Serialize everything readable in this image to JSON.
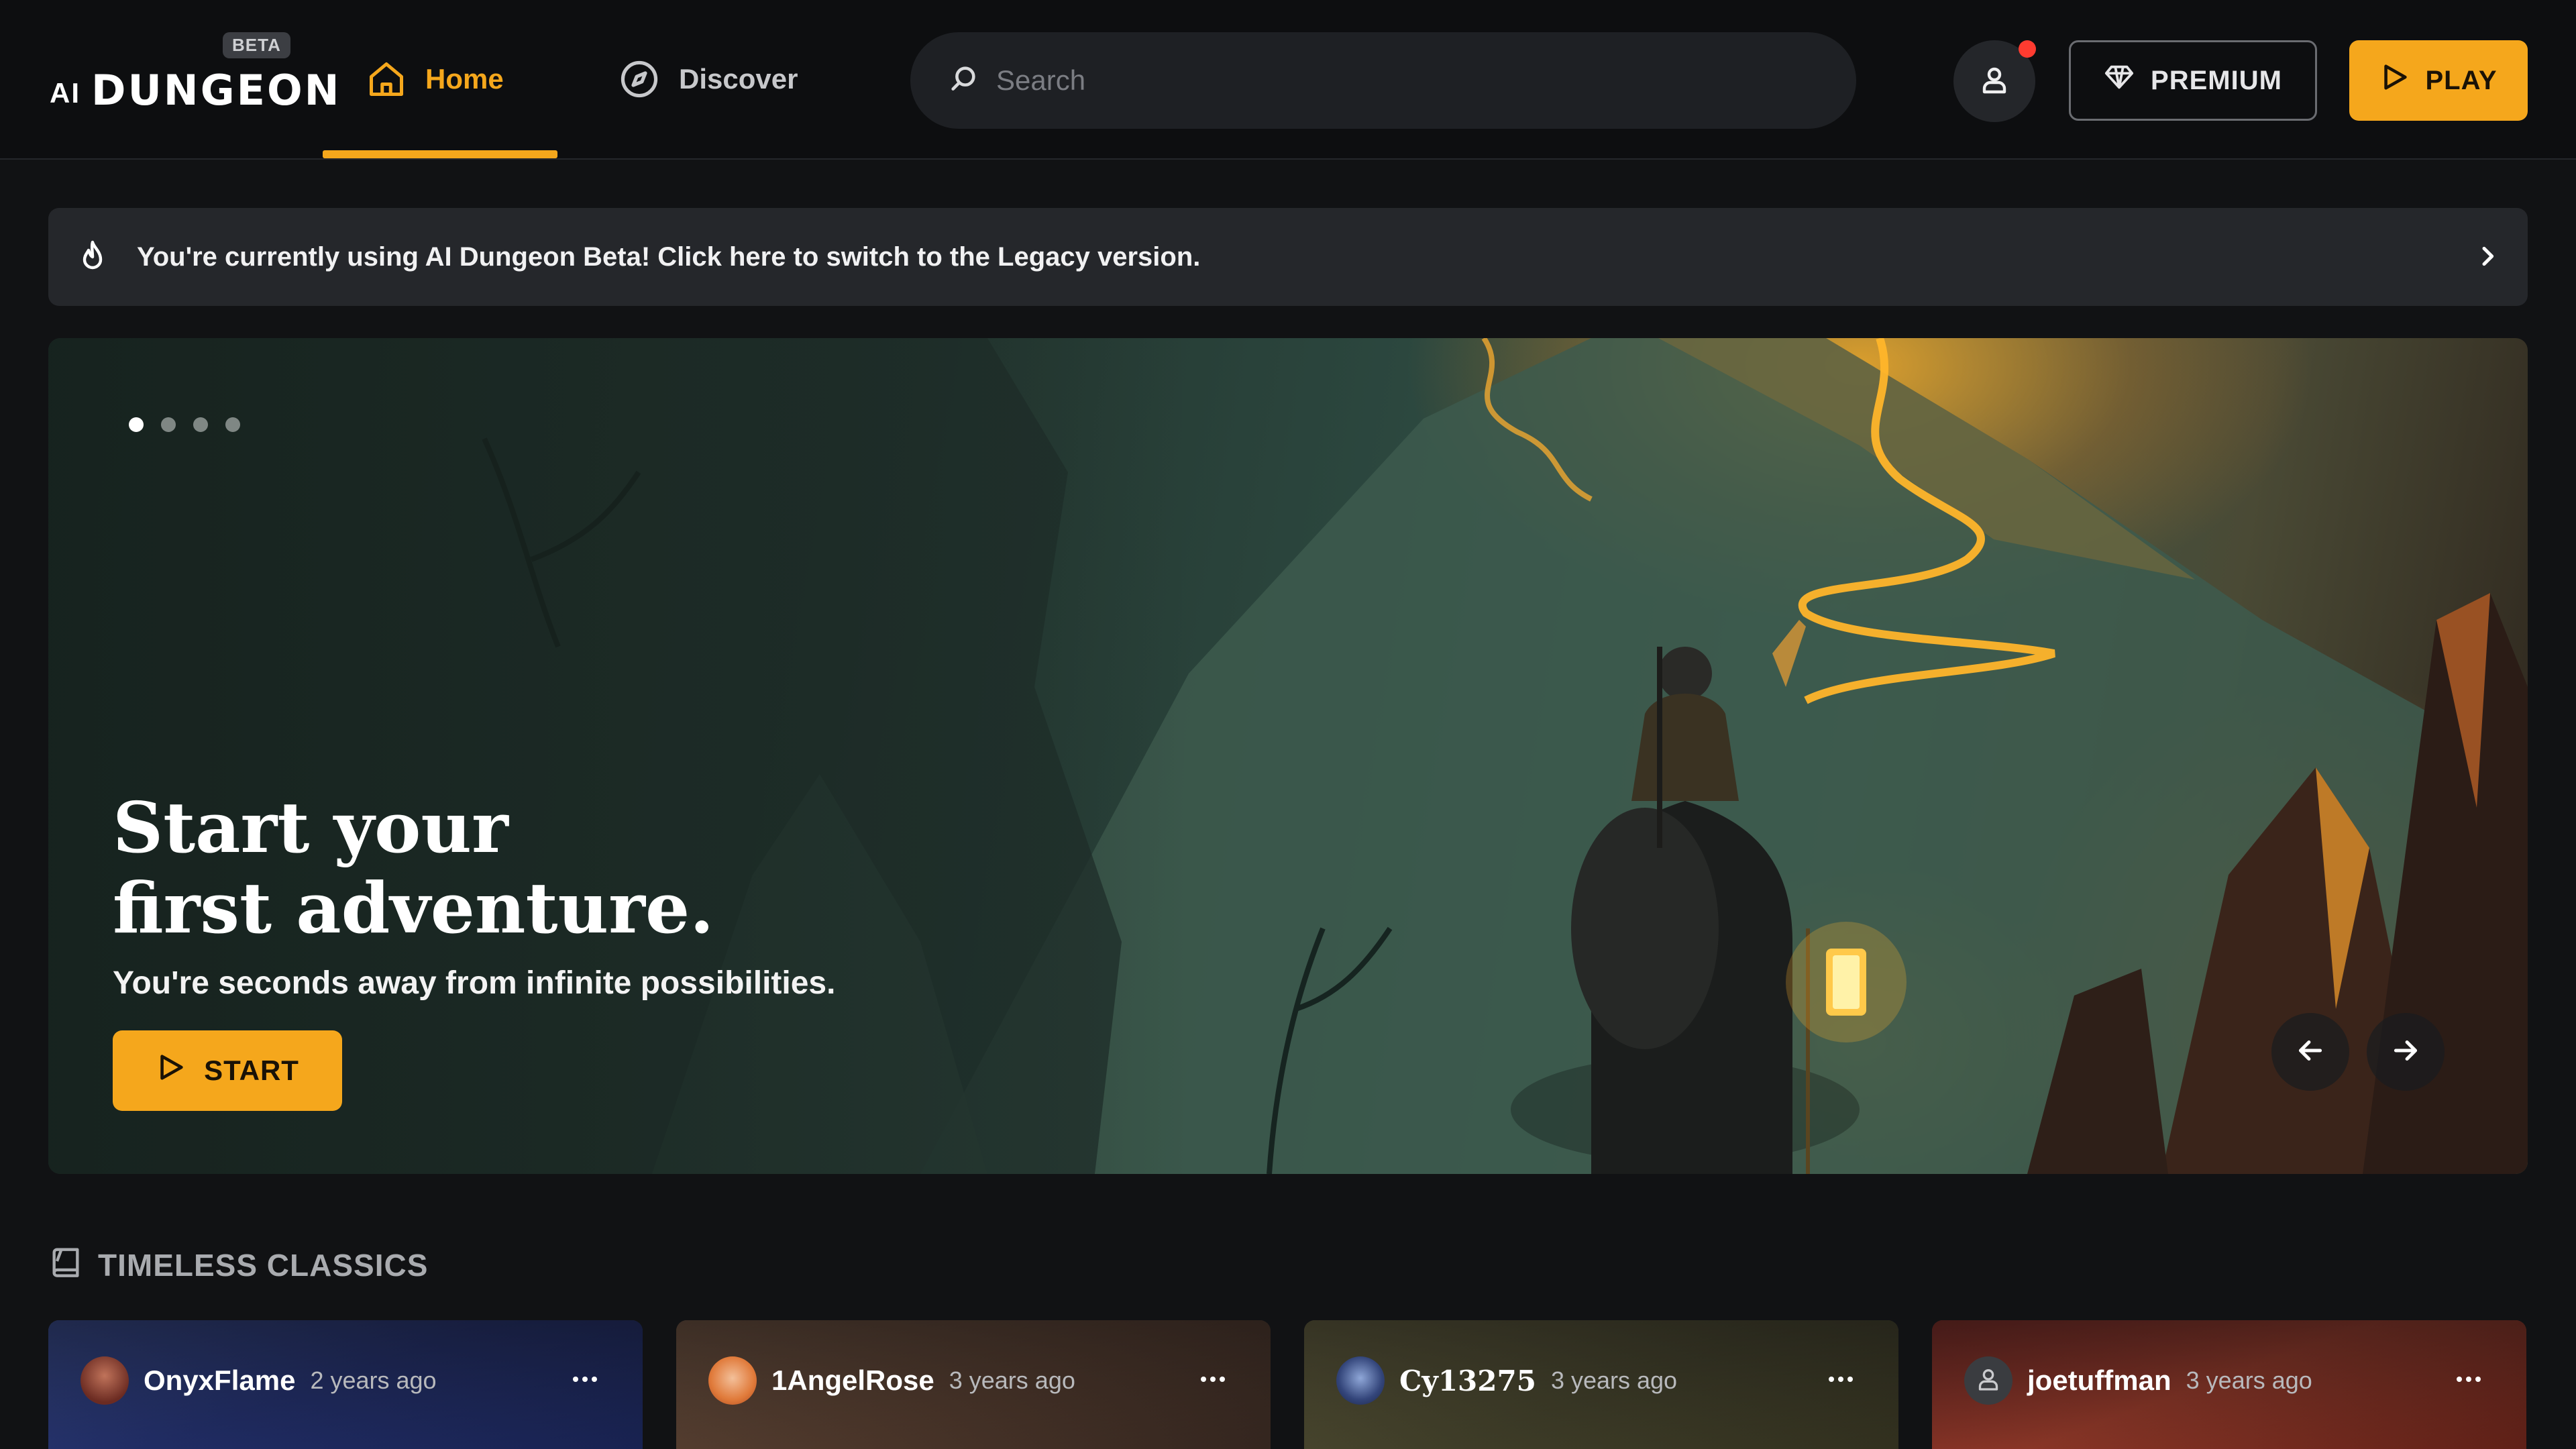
{
  "header": {
    "logo_ai": "AI",
    "logo_name": "DUNGEON",
    "beta_badge": "BETA",
    "nav": {
      "home": "Home",
      "discover": "Discover"
    },
    "search_placeholder": "Search",
    "premium_label": "PREMIUM",
    "play_label": "PLAY"
  },
  "banner": {
    "text": "You're currently using AI Dungeon Beta! Click here to switch to the Legacy version."
  },
  "hero": {
    "title_line1": "Start your",
    "title_line2": "first adventure.",
    "subtitle": "You're seconds away from infinite possibilities.",
    "start_label": "START",
    "slides": 4,
    "active_slide": 1
  },
  "section": {
    "title": "TIMELESS CLASSICS",
    "cards": [
      {
        "user": "OnyxFlame",
        "time": "2 years ago"
      },
      {
        "user": "1AngelRose",
        "time": "3 years ago"
      },
      {
        "user": "Cy13275",
        "time": "3 years ago"
      },
      {
        "user": "joetuffman",
        "time": "3 years ago"
      }
    ]
  },
  "colors": {
    "accent": "#f5a71c",
    "background": "#111214",
    "notification": "#ff3b30"
  },
  "icons": [
    "home-icon",
    "compass-icon",
    "search-icon",
    "user-icon",
    "diamond-icon",
    "play-icon",
    "flame-icon",
    "chevron-right-icon",
    "arrow-left-icon",
    "arrow-right-icon",
    "book-icon",
    "more-icon"
  ]
}
